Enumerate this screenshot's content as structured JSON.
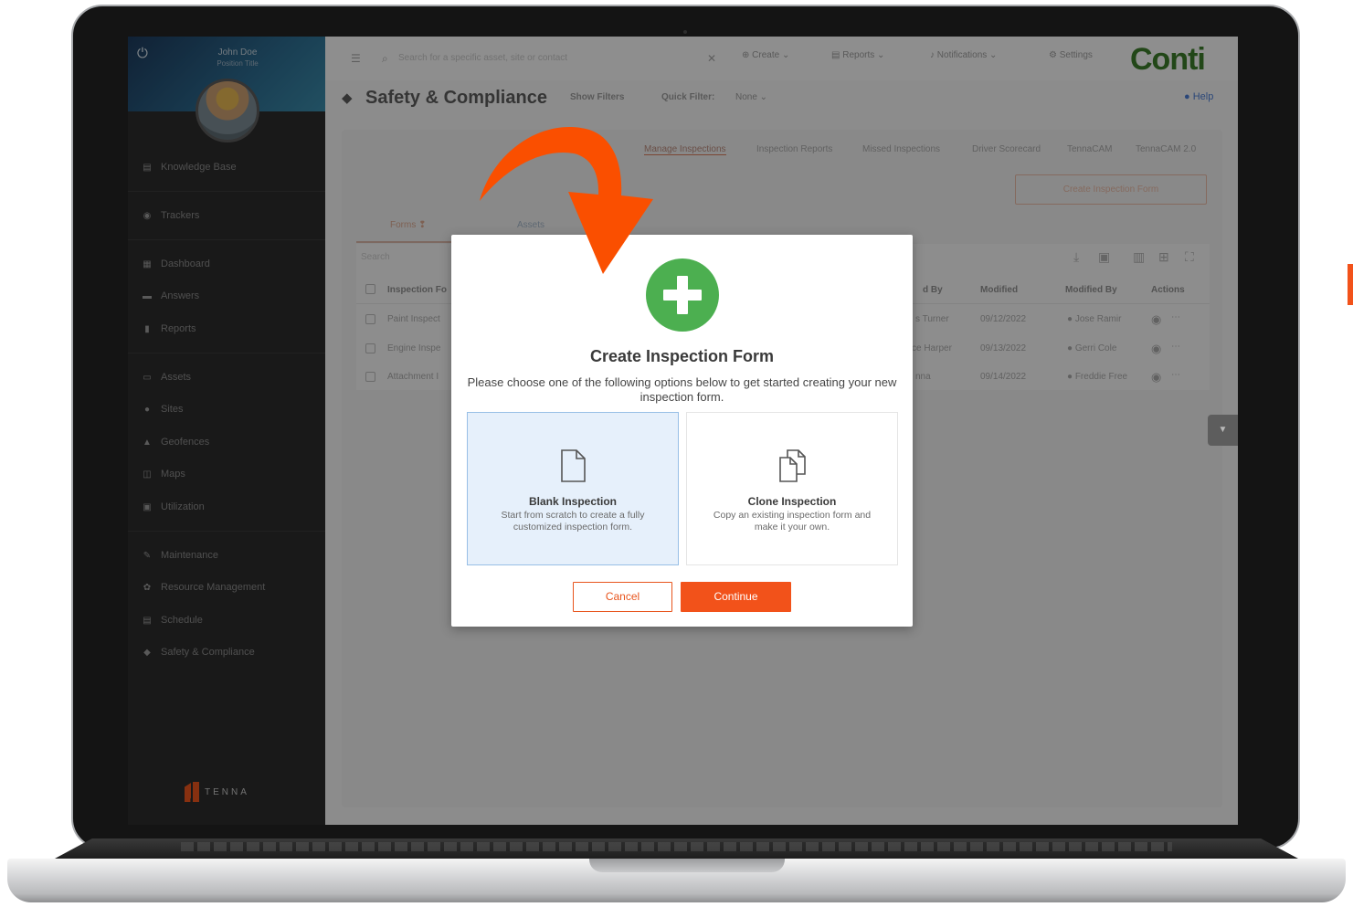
{
  "sidebar": {
    "user_name": "John Doe",
    "user_position": "Position Title",
    "items": [
      {
        "label": "Knowledge Base",
        "icon": "book-icon"
      },
      {
        "label": "Trackers",
        "icon": "tracker-icon"
      },
      {
        "label": "Dashboard",
        "icon": "dashboard-icon"
      },
      {
        "label": "Answers",
        "icon": "chat-icon"
      },
      {
        "label": "Reports",
        "icon": "report-icon"
      },
      {
        "label": "Assets",
        "icon": "asset-icon"
      },
      {
        "label": "Sites",
        "icon": "pin-icon"
      },
      {
        "label": "Geofences",
        "icon": "geofence-icon"
      },
      {
        "label": "Maps",
        "icon": "map-icon"
      },
      {
        "label": "Utilization",
        "icon": "utilization-icon"
      },
      {
        "label": "Maintenance",
        "icon": "wrench-icon"
      },
      {
        "label": "Resource Management",
        "icon": "resource-icon"
      },
      {
        "label": "Schedule",
        "icon": "calendar-icon"
      },
      {
        "label": "Safety & Compliance",
        "icon": "shield-icon"
      }
    ],
    "logo_text": "TENNA"
  },
  "topbar": {
    "search_placeholder": "Search for a specific asset, site or contact",
    "create_label": "Create",
    "reports_label": "Reports",
    "notifications_label": "Notifications",
    "settings_label": "Settings",
    "brand": "Conti"
  },
  "page": {
    "title": "Safety & Compliance",
    "show_filters": "Show Filters",
    "quick_filter_label": "Quick Filter:",
    "quick_filter_value": "None",
    "help": "Help"
  },
  "tabs": [
    "Manage Inspections",
    "Inspection Reports",
    "Missed Inspections",
    "Driver Scorecard",
    "TennaCAM",
    "TennaCAM 2.0"
  ],
  "create_inspection_button": "Create Inspection Form",
  "subtabs": [
    "Forms",
    "Assets"
  ],
  "table": {
    "search_placeholder": "Search",
    "headers": [
      "Inspection Fo",
      "d By",
      "Modified",
      "Modified By",
      "Actions"
    ],
    "rows": [
      {
        "name": "Paint Inspect",
        "by": "s Turner",
        "modified": "09/12/2022",
        "modified_by": "Jose Ramir"
      },
      {
        "name": "Engine Inspe",
        "by": "ce Harper",
        "modified": "09/13/2022",
        "modified_by": "Gerri Cole"
      },
      {
        "name": "Attachment I",
        "by": "nna",
        "modified": "09/14/2022",
        "modified_by": "Freddie Free"
      }
    ]
  },
  "modal": {
    "title": "Create Inspection Form",
    "description": "Please choose one of the following options below to get started creating your new inspection form.",
    "options": [
      {
        "title": "Blank Inspection",
        "description": "Start from scratch to create a fully customized inspection form.",
        "selected": true
      },
      {
        "title": "Clone Inspection",
        "description": "Copy an existing inspection form and make it your own.",
        "selected": false
      }
    ],
    "cancel_label": "Cancel",
    "continue_label": "Continue"
  },
  "colors": {
    "accent": "#f2521a",
    "success": "#4caf50",
    "brand": "#3b7a2a"
  }
}
